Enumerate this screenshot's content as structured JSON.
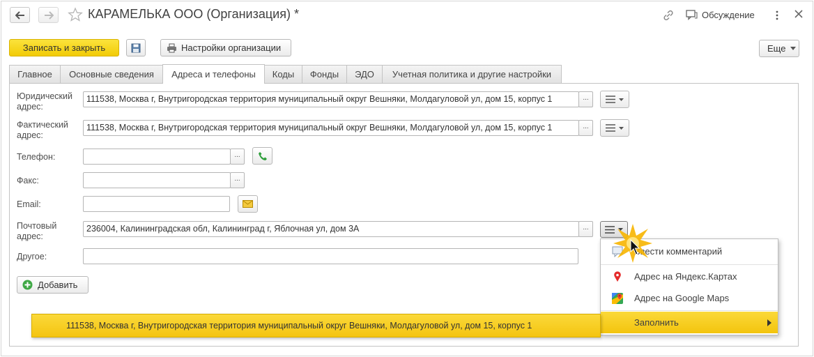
{
  "header": {
    "title": "КАРАМЕЛЬКА ООО (Организация) *",
    "discussion_label": "Обсуждение"
  },
  "toolbar": {
    "save_close_label": "Записать и закрыть",
    "org_settings_label": "Настройки организации",
    "more_label": "Еще"
  },
  "tabs": [
    {
      "label": "Главное"
    },
    {
      "label": "Основные сведения"
    },
    {
      "label": "Адреса и телефоны"
    },
    {
      "label": "Коды"
    },
    {
      "label": "Фонды"
    },
    {
      "label": "ЭДО"
    },
    {
      "label": "Учетная политика и другие настройки"
    }
  ],
  "form": {
    "legal_address": {
      "label_line1": "Юридический",
      "label_line2": "адрес:",
      "value": "111538, Москва г, Внутригородская территория муниципальный округ Вешняки, Молдагуловой ул, дом 15, корпус 1"
    },
    "actual_address": {
      "label_line1": "Фактический",
      "label_line2": "адрес:",
      "value": "111538, Москва г, Внутригородская территория муниципальный округ Вешняки, Молдагуловой ул, дом 15, корпус 1"
    },
    "phone": {
      "label": "Телефон:",
      "value": ""
    },
    "fax": {
      "label": "Факс:",
      "value": ""
    },
    "email": {
      "label": "Email:",
      "value": ""
    },
    "postal_address": {
      "label_line1": "Почтовый",
      "label_line2": "адрес:",
      "value": "236004, Калининградская обл, Калининград г, Яблочная ул, дом 3А"
    },
    "other": {
      "label": "Другое:",
      "value": ""
    },
    "add_label": "Добавить",
    "dots_label": "..."
  },
  "popup_menu": {
    "items": [
      {
        "label": "Ввести комментарий",
        "icon": "comment-icon"
      },
      {
        "label": "Адрес на Яндекс.Картах",
        "icon": "yandex-pin-icon"
      },
      {
        "label": "Адрес на Google Maps",
        "icon": "google-maps-icon"
      },
      {
        "label": "Заполнить",
        "icon": "submenu-arrow-icon"
      }
    ]
  },
  "suggestion": {
    "value": "111538, Москва г, Внутригородская территория муниципальный округ Вешняки, Молдагуловой ул, дом 15, корпус 1"
  },
  "colors": {
    "accent_yellow": "#f4c410",
    "phone_green": "#2e9e3a"
  }
}
